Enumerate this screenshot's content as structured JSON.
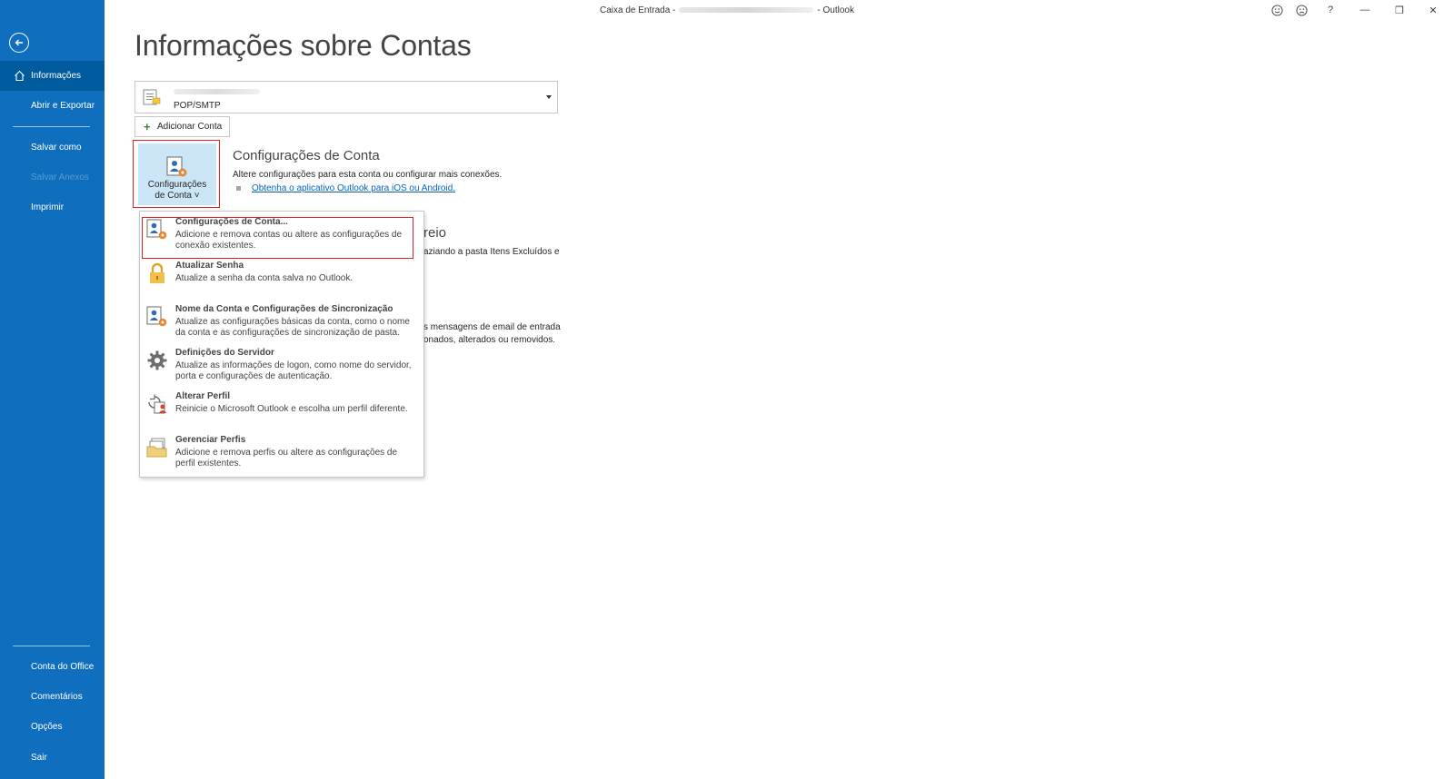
{
  "window": {
    "title_prefix": "Caixa de Entrada -",
    "title_suffix": "- Outlook",
    "controls": [
      "smiley-icon",
      "frown-icon",
      "help-icon",
      "minimize-icon",
      "restore-icon",
      "close-icon"
    ],
    "help_label": "?",
    "minimize_label": "—",
    "restore_label": "❐",
    "close_label": "✕"
  },
  "sidebar": {
    "items": [
      {
        "label": "Informações",
        "active": true
      },
      {
        "label": "Abrir e Exportar"
      },
      {
        "label": "Salvar como"
      },
      {
        "label": "Salvar Anexos",
        "disabled": true
      },
      {
        "label": "Imprimir"
      },
      {
        "label": "Conta do Office"
      },
      {
        "label": "Comentários"
      },
      {
        "label": "Opções"
      },
      {
        "label": "Sair"
      }
    ]
  },
  "main": {
    "page_title": "Informações sobre Contas",
    "account_type": "POP/SMTP",
    "add_account_label": "Adicionar Conta",
    "account_settings_button": {
      "line1": "Configurações",
      "line2": "de Conta ˅"
    },
    "section": {
      "title": "Configurações de Conta",
      "description": "Altere configurações para esta conta ou configurar mais conexões.",
      "link": "Obtenha o aplicativo Outlook para iOS ou Android."
    },
    "background_fragments": {
      "title": "reio",
      "line1": "aziando a pasta Itens Excluídos e",
      "line2": "s mensagens de email de entrada",
      "line3": "onados, alterados ou removidos."
    }
  },
  "menu": {
    "items": [
      {
        "icon": "account-settings-icon",
        "title": "Configurações de Conta...",
        "desc": "Adicione e remova contas ou altere as configurações de conexão existentes."
      },
      {
        "icon": "lock-icon",
        "title": "Atualizar Senha",
        "desc": "Atualize a senha da conta salva no Outlook."
      },
      {
        "icon": "account-sync-icon",
        "title": "Nome da Conta e Configurações de Sincronização",
        "desc": "Atualize as configurações básicas da conta, como o nome da conta e as configurações de sincronização de pasta."
      },
      {
        "icon": "gear-icon",
        "title": "Definições do Servidor",
        "desc": "Atualize as informações de logon, como nome do servidor, porta e configurações de autenticação."
      },
      {
        "icon": "change-profile-icon",
        "title": "Alterar Perfil",
        "desc": "Reinicie o Microsoft Outlook e escolha um perfil diferente."
      },
      {
        "icon": "manage-profiles-icon",
        "title": "Gerenciar Perfis",
        "desc": "Adicione e remova perfis ou altere as configurações de perfil existentes."
      }
    ]
  },
  "colors": {
    "sidebar": "#106ebe",
    "sidebar_active": "#005a9e",
    "highlight_box": "#e0201f",
    "link": "#0563c1"
  }
}
